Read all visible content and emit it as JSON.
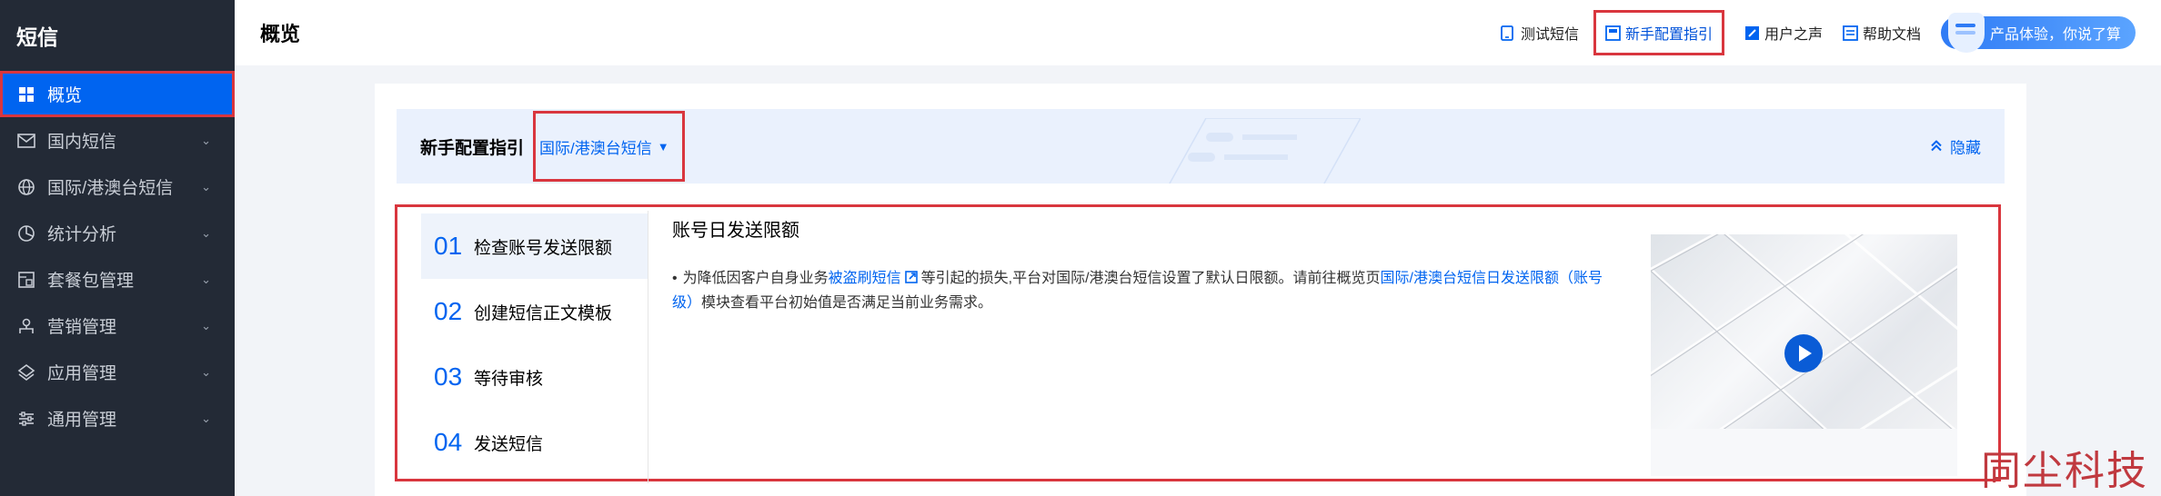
{
  "sidebar": {
    "brand": "短信",
    "items": [
      {
        "label": "概览",
        "icon": "grid-icon",
        "active": true
      },
      {
        "label": "国内短信",
        "icon": "mail-icon"
      },
      {
        "label": "国际/港澳台短信",
        "icon": "globe-icon"
      },
      {
        "label": "统计分析",
        "icon": "pie-chart-icon"
      },
      {
        "label": "套餐包管理",
        "icon": "package-icon"
      },
      {
        "label": "营销管理",
        "icon": "people-icon"
      },
      {
        "label": "应用管理",
        "icon": "layers-icon"
      },
      {
        "label": "通用管理",
        "icon": "settings-sliders-icon"
      }
    ]
  },
  "header": {
    "title": "概览",
    "links": {
      "test_sms": "测试短信",
      "new_guide": "新手配置指引",
      "user_voice": "用户之声",
      "help_docs": "帮助文档"
    },
    "feedback": "产品体验，你说了算"
  },
  "guide": {
    "title": "新手配置指引",
    "region": "国际/港澳台短信",
    "collapse": "隐藏",
    "steps": [
      {
        "num": "01",
        "label": "检查账号发送限额",
        "active": true
      },
      {
        "num": "02",
        "label": "创建短信正文模板"
      },
      {
        "num": "03",
        "label": "等待审核"
      },
      {
        "num": "04",
        "label": "发送短信"
      }
    ],
    "detail": {
      "title": "账号日发送限额",
      "text_1": "为降低因客户自身业务",
      "link_1": "被盗刷短信",
      "text_2": "等引起的损失,平台对国际/港澳台短信设置了默认日限额。请前往概览页",
      "link_2": "国际/港澳台短信日发送限额（账号级）",
      "text_3": "模块查看平台初始值是否满足当前业务需求。"
    }
  },
  "watermark": "同尘科技",
  "colors": {
    "sidebar_bg": "#232a36",
    "accent": "#0064f0",
    "highlight_border": "#d9363e"
  }
}
